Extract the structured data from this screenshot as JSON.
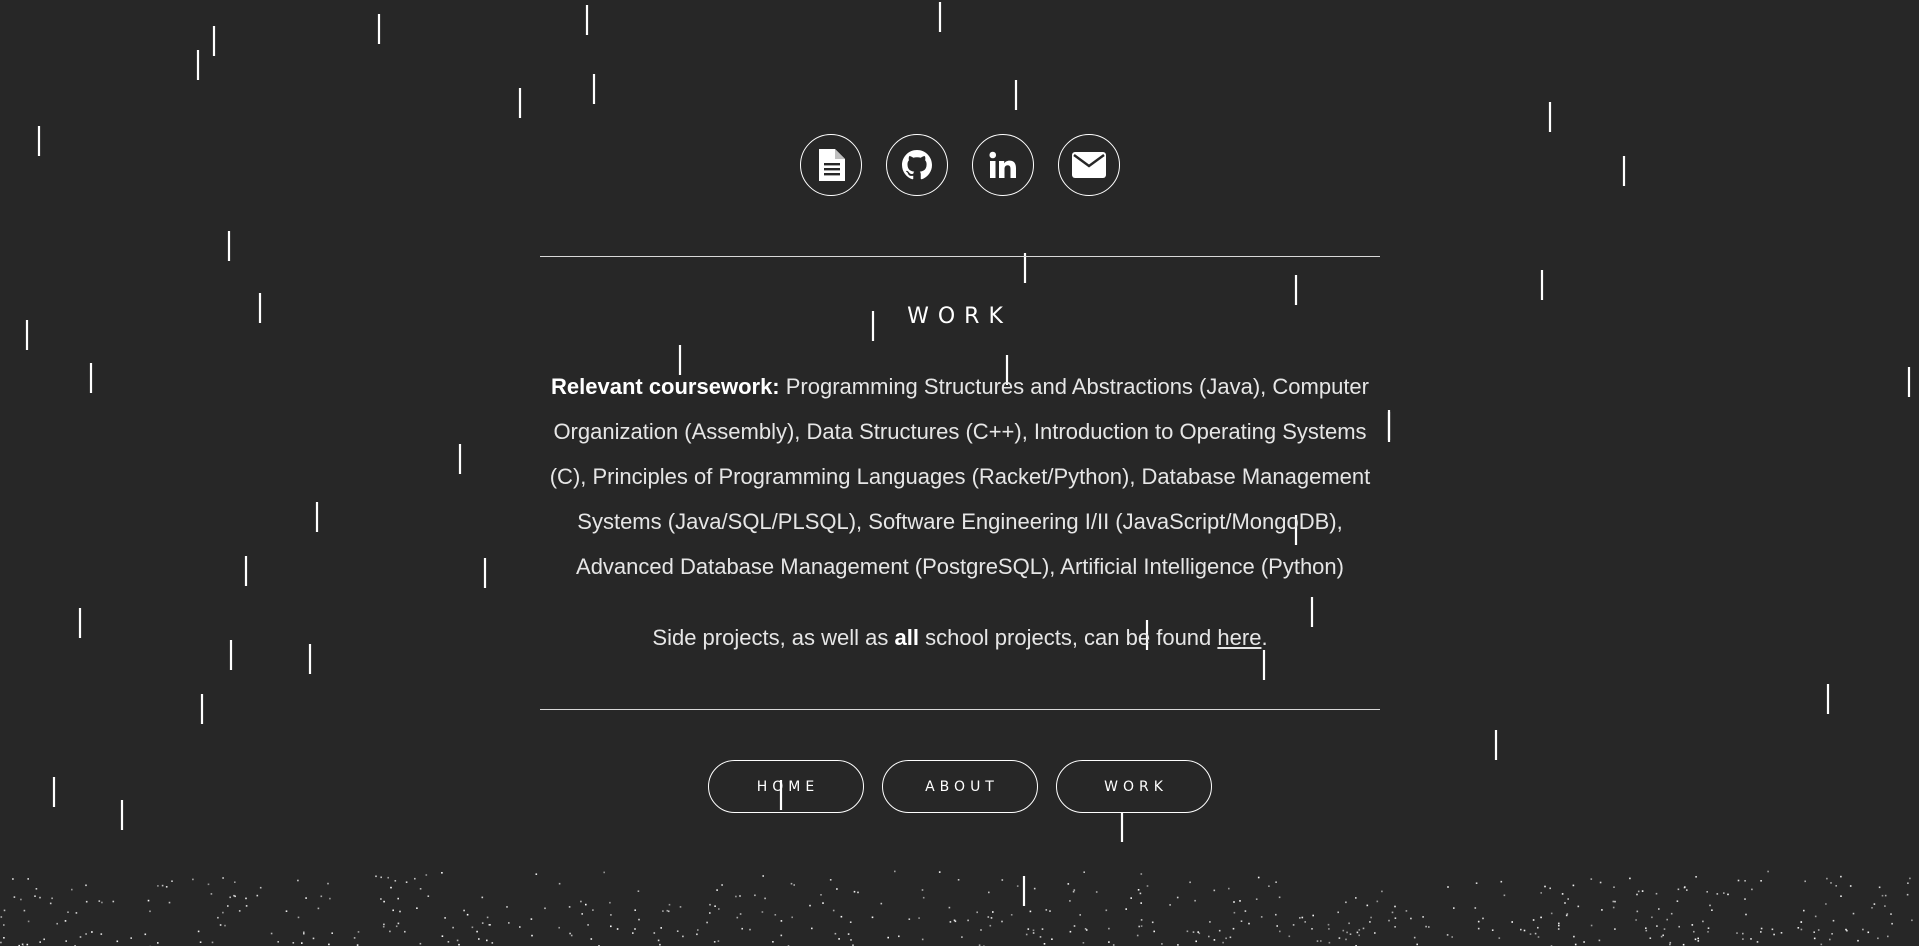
{
  "social_icons": [
    {
      "name": "resume-icon"
    },
    {
      "name": "github-icon"
    },
    {
      "name": "linkedin-icon"
    },
    {
      "name": "email-icon"
    }
  ],
  "section": {
    "title": "WORK",
    "coursework_label": "Relevant coursework:",
    "coursework_text": " Programming Structures and Abstractions (Java), Computer Organization (Assembly), Data Structures (C++), Introduction to Operating Systems (C), Principles of Programming Languages (Racket/Python), Database Management Systems (Java/SQL/PLSQL), Software Engineering I/II (JavaScript/MongoDB), Advanced Database Management (PostgreSQL), Artificial Intelligence (Python)",
    "side_prefix": "Side projects, as well as ",
    "side_bold": "all",
    "side_middle": " school projects, can be found ",
    "side_link": "here",
    "side_suffix": "."
  },
  "nav": {
    "home": "HOME",
    "about": "ABOUT",
    "work": "WORK"
  },
  "colors": {
    "background": "#272727",
    "foreground": "#ffffff"
  }
}
